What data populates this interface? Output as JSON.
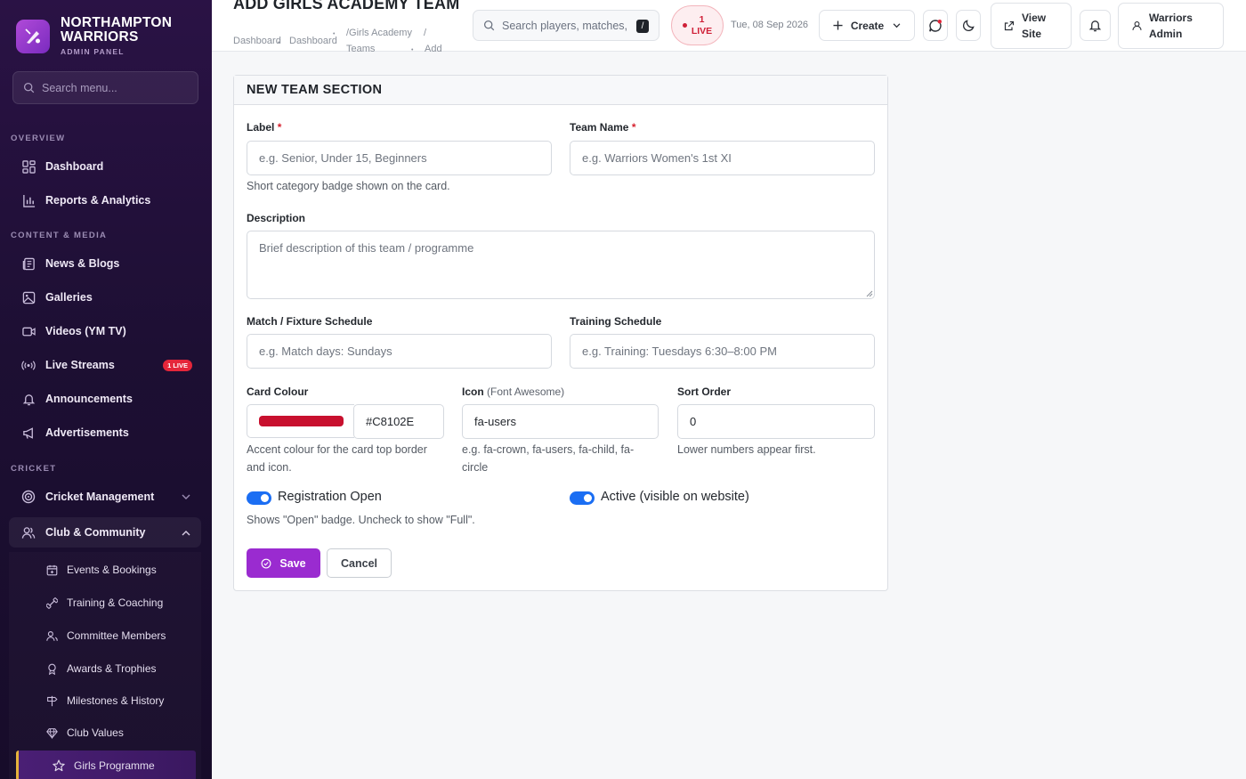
{
  "brand": {
    "title_line1": "NORTHAMPTON",
    "title_line2": "WARRIORS",
    "subtitle": "ADMIN PANEL"
  },
  "sidebar": {
    "search_placeholder": "Search menu...",
    "sections": {
      "overview": "OVERVIEW",
      "content": "CONTENT & MEDIA",
      "cricket": "CRICKET"
    },
    "items": {
      "dashboard": "Dashboard",
      "reports": "Reports & Analytics",
      "news": "News & Blogs",
      "galleries": "Galleries",
      "videos": "Videos (YM TV)",
      "live_streams": "Live Streams",
      "live_badge": "1 LIVE",
      "announcements": "Announcements",
      "ads": "Advertisements",
      "cricket_mgmt": "Cricket Management",
      "club": "Club & Community"
    },
    "subitems": {
      "events": "Events & Bookings",
      "training": "Training & Coaching",
      "committee": "Committee Members",
      "awards": "Awards & Trophies",
      "milestones": "Milestones & History",
      "values": "Club Values",
      "girls": "Girls Programme"
    }
  },
  "header": {
    "title": "ADD GIRLS ACADEMY TEAM",
    "breadcrumb": {
      "c1": "Dashboard",
      "c2": "Dashboard",
      "c3": "/Girls Academy",
      "c3b": "Teams",
      "c4": "/",
      "c5": "Add"
    },
    "search_placeholder": "Search players, matches, r",
    "search_kbd": "/",
    "live": {
      "count": "1",
      "label": "LIVE"
    },
    "date": "Tue, 08 Sep 2026",
    "create": "Create",
    "view_site_1": "View",
    "view_site_2": "Site",
    "user_1": "Warriors",
    "user_2": "Admin"
  },
  "form": {
    "section_title": "NEW TEAM SECTION",
    "label": {
      "label": "Label",
      "req": "*",
      "placeholder": "e.g. Senior, Under 15, Beginners",
      "help": "Short category badge shown on the card."
    },
    "team_name": {
      "label": "Team Name",
      "req": "*",
      "placeholder": "e.g. Warriors Women's 1st XI"
    },
    "description": {
      "label": "Description",
      "placeholder": "Brief description of this team / programme"
    },
    "match_schedule": {
      "label": "Match / Fixture Schedule",
      "placeholder": "e.g. Match days: Sundays"
    },
    "training_schedule": {
      "label": "Training Schedule",
      "placeholder": "e.g. Training: Tuesdays 6:30–8:00 PM"
    },
    "card_colour": {
      "label": "Card Colour",
      "value": "#C8102E",
      "help_1": "Accent colour for the card top border",
      "help_2": "and icon."
    },
    "icon": {
      "label": "Icon",
      "label_suffix": "(Font Awesome)",
      "value": "fa-users",
      "help_1": "e.g. fa-crown, fa-users, fa-child, fa-",
      "help_2": "circle"
    },
    "sort_order": {
      "label": "Sort Order",
      "value": "0",
      "help": "Lower numbers appear first."
    },
    "registration": {
      "label": "Registration Open",
      "checked": true,
      "help": "Shows \"Open\" badge. Uncheck to show \"Full\"."
    },
    "active": {
      "label": "Active (visible on website)",
      "checked": true
    },
    "save": "Save",
    "cancel": "Cancel"
  },
  "colors": {
    "accent": "#9A2BD0",
    "swatch": "#C8102E",
    "toggle": "#1B6EF3",
    "live": "#CF1F37"
  }
}
